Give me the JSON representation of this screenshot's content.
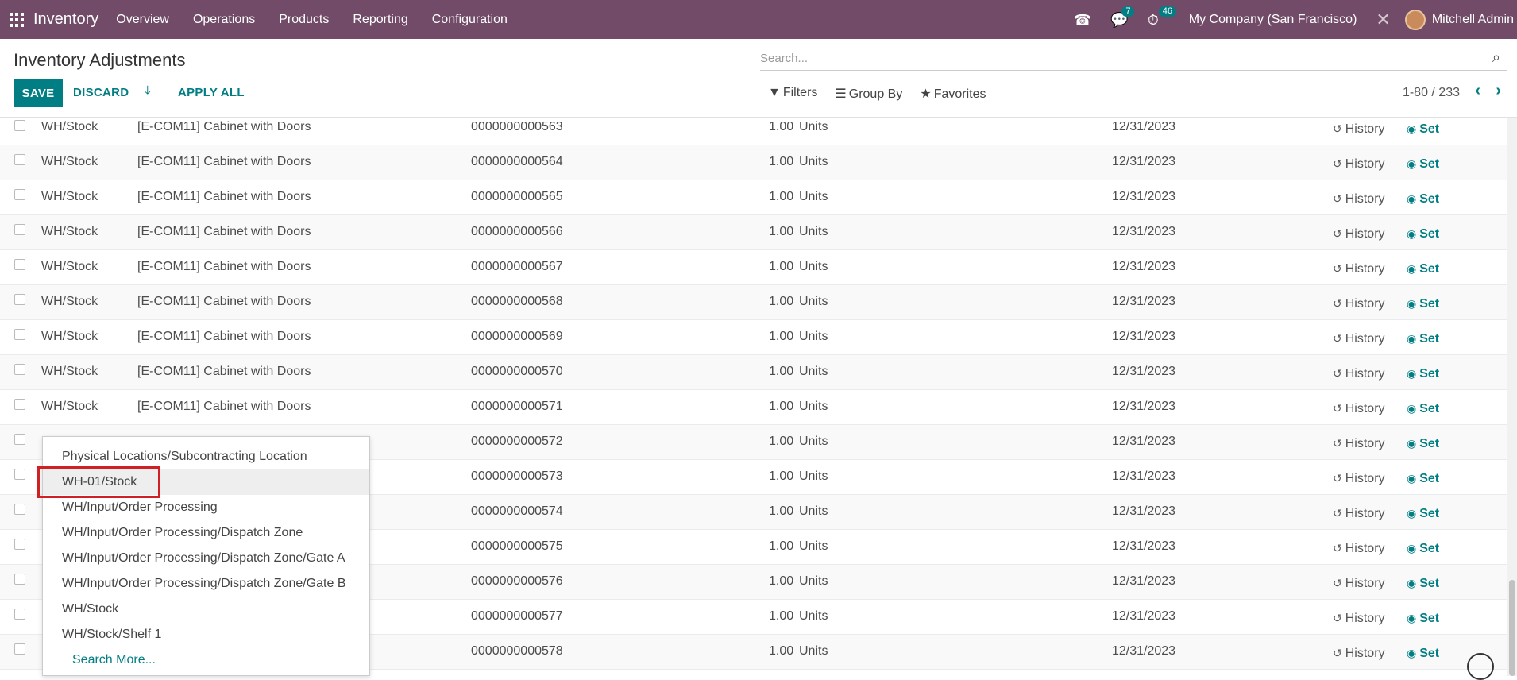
{
  "navbar": {
    "brand": "Inventory",
    "menu": [
      "Overview",
      "Operations",
      "Products",
      "Reporting",
      "Configuration"
    ],
    "messages_count": "7",
    "activities_count": "46",
    "company": "My Company (San Francisco)",
    "user": "Mitchell Admin"
  },
  "control_panel": {
    "title": "Inventory Adjustments",
    "save_label": "SAVE",
    "discard_label": "DISCARD",
    "apply_all_label": "APPLY ALL",
    "search_placeholder": "Search...",
    "filters_label": "Filters",
    "group_by_label": "Group By",
    "favorites_label": "Favorites",
    "pager_value": "1-80 / 233"
  },
  "list": {
    "history_label": "History",
    "set_label": "Set",
    "rows": [
      {
        "location": "WH/Stock",
        "product": "[E-COM11] Cabinet with Doors",
        "lot": "0000000000563",
        "qty": "1.00",
        "uom": "Units",
        "date": "12/31/2023"
      },
      {
        "location": "WH/Stock",
        "product": "[E-COM11] Cabinet with Doors",
        "lot": "0000000000564",
        "qty": "1.00",
        "uom": "Units",
        "date": "12/31/2023"
      },
      {
        "location": "WH/Stock",
        "product": "[E-COM11] Cabinet with Doors",
        "lot": "0000000000565",
        "qty": "1.00",
        "uom": "Units",
        "date": "12/31/2023"
      },
      {
        "location": "WH/Stock",
        "product": "[E-COM11] Cabinet with Doors",
        "lot": "0000000000566",
        "qty": "1.00",
        "uom": "Units",
        "date": "12/31/2023"
      },
      {
        "location": "WH/Stock",
        "product": "[E-COM11] Cabinet with Doors",
        "lot": "0000000000567",
        "qty": "1.00",
        "uom": "Units",
        "date": "12/31/2023"
      },
      {
        "location": "WH/Stock",
        "product": "[E-COM11] Cabinet with Doors",
        "lot": "0000000000568",
        "qty": "1.00",
        "uom": "Units",
        "date": "12/31/2023"
      },
      {
        "location": "WH/Stock",
        "product": "[E-COM11] Cabinet with Doors",
        "lot": "0000000000569",
        "qty": "1.00",
        "uom": "Units",
        "date": "12/31/2023"
      },
      {
        "location": "WH/Stock",
        "product": "[E-COM11] Cabinet with Doors",
        "lot": "0000000000570",
        "qty": "1.00",
        "uom": "Units",
        "date": "12/31/2023"
      },
      {
        "location": "WH/Stock",
        "product": "[E-COM11] Cabinet with Doors",
        "lot": "0000000000571",
        "qty": "1.00",
        "uom": "Units",
        "date": "12/31/2023"
      },
      {
        "location": "",
        "product": "",
        "lot": "0000000000572",
        "qty": "1.00",
        "uom": "Units",
        "date": "12/31/2023"
      },
      {
        "location": "",
        "product": "",
        "lot": "0000000000573",
        "qty": "1.00",
        "uom": "Units",
        "date": "12/31/2023"
      },
      {
        "location": "",
        "product": "",
        "lot": "0000000000574",
        "qty": "1.00",
        "uom": "Units",
        "date": "12/31/2023"
      },
      {
        "location": "",
        "product": "",
        "lot": "0000000000575",
        "qty": "1.00",
        "uom": "Units",
        "date": "12/31/2023"
      },
      {
        "location": "",
        "product": "",
        "lot": "0000000000576",
        "qty": "1.00",
        "uom": "Units",
        "date": "12/31/2023"
      },
      {
        "location": "",
        "product": "",
        "lot": "0000000000577",
        "qty": "1.00",
        "uom": "Units",
        "date": "12/31/2023"
      },
      {
        "location": "",
        "product": "",
        "lot": "0000000000578",
        "qty": "1.00",
        "uom": "Units",
        "date": "12/31/2023"
      }
    ]
  },
  "dropdown": {
    "items": [
      "Physical Locations/Subcontracting Location",
      "WH-01/Stock",
      "WH/Input/Order Processing",
      "WH/Input/Order Processing/Dispatch Zone",
      "WH/Input/Order Processing/Dispatch Zone/Gate A",
      "WH/Input/Order Processing/Dispatch Zone/Gate B",
      "WH/Stock",
      "WH/Stock/Shelf 1"
    ],
    "search_more": "Search More..."
  }
}
